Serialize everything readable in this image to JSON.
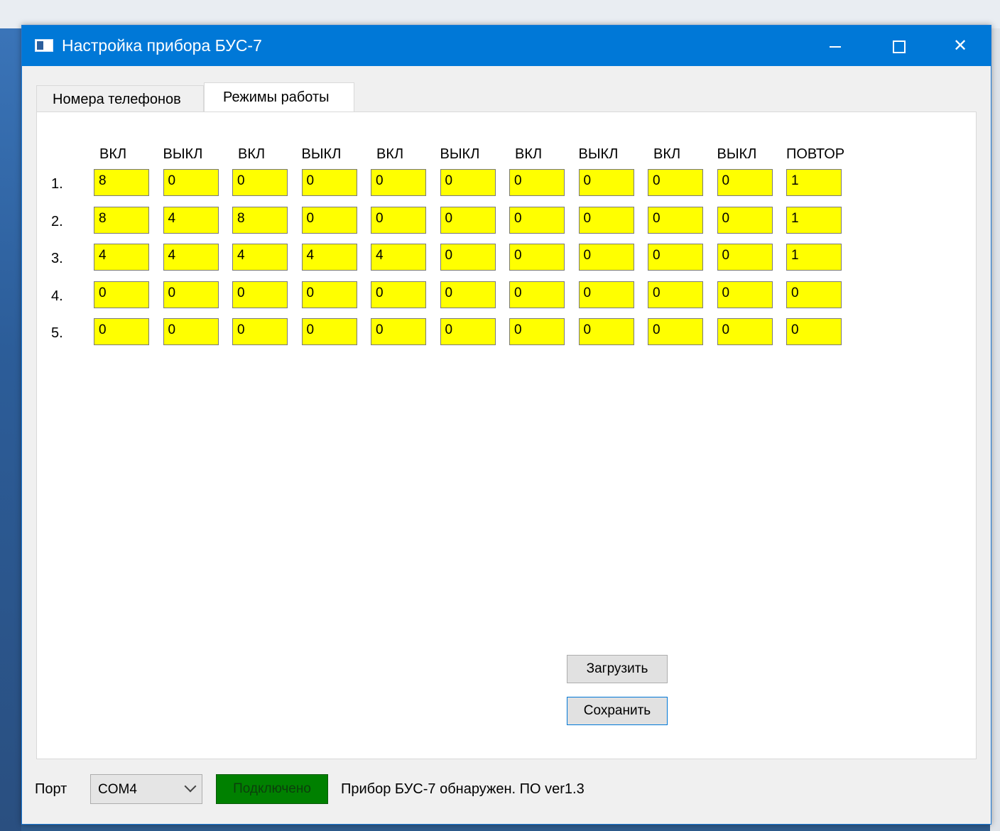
{
  "window": {
    "title": "Настройка прибора БУС-7"
  },
  "tabs": [
    {
      "label": "Номера телефонов"
    },
    {
      "label": "Режимы работы"
    }
  ],
  "grid": {
    "headers": [
      "ВКЛ",
      "ВЫКЛ",
      "ВКЛ",
      "ВЫКЛ",
      "ВКЛ",
      "ВЫКЛ",
      "ВКЛ",
      "ВЫКЛ",
      "ВКЛ",
      "ВЫКЛ",
      "ПОВТОР"
    ],
    "rows": [
      {
        "label": "1.",
        "values": [
          "8",
          "0",
          "0",
          "0",
          "0",
          "0",
          "0",
          "0",
          "0",
          "0",
          "1"
        ]
      },
      {
        "label": "2.",
        "values": [
          "8",
          "4",
          "8",
          "0",
          "0",
          "0",
          "0",
          "0",
          "0",
          "0",
          "1"
        ]
      },
      {
        "label": "3.",
        "values": [
          "4",
          "4",
          "4",
          "4",
          "4",
          "0",
          "0",
          "0",
          "0",
          "0",
          "1"
        ]
      },
      {
        "label": "4.",
        "values": [
          "0",
          "0",
          "0",
          "0",
          "0",
          "0",
          "0",
          "0",
          "0",
          "0",
          "0"
        ]
      },
      {
        "label": "5.",
        "values": [
          "0",
          "0",
          "0",
          "0",
          "0",
          "0",
          "0",
          "0",
          "0",
          "0",
          "0"
        ]
      }
    ]
  },
  "buttons": {
    "load": "Загрузить",
    "save": "Сохранить"
  },
  "status": {
    "port_label": "Порт",
    "port_value": "COM4",
    "connection": "Подключено",
    "message": "Прибор БУС-7 обнаружен. ПО ver1.3"
  },
  "colors": {
    "cell_bg": "#ffff00",
    "connected_bg": "#008000",
    "titlebar": "#0078d7"
  }
}
